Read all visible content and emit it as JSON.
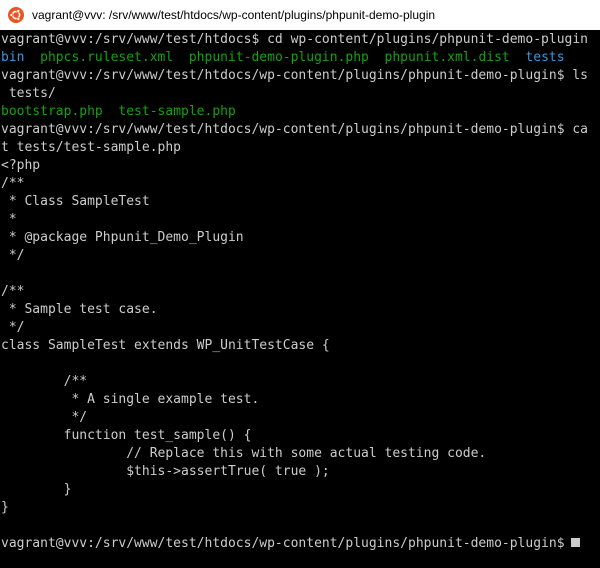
{
  "window": {
    "title": "vagrant@vvv: /srv/www/test/htdocs/wp-content/plugins/phpunit-demo-plugin",
    "icon": "ubuntu-logo-icon",
    "accent_color": "#e95420"
  },
  "terminal": {
    "colors": {
      "text": "#cccccc",
      "file": "#13a10e",
      "directory": "#3a96dd",
      "background": "#000000"
    },
    "lines": [
      "vagrant@vvv:/srv/www/test/htdocs$ cd wp-content/plugins/phpunit-demo-plugin",
      {
        "segments": [
          {
            "text": "bin",
            "style": "blue"
          },
          {
            "text": "  ",
            "style": ""
          },
          {
            "text": "phpcs.ruleset.xml",
            "style": "green"
          },
          {
            "text": "  ",
            "style": ""
          },
          {
            "text": "phpunit-demo-plugin.php",
            "style": "green"
          },
          {
            "text": "  ",
            "style": ""
          },
          {
            "text": "phpunit.xml.dist",
            "style": "green"
          },
          {
            "text": "  ",
            "style": ""
          },
          {
            "text": "tests",
            "style": "blue"
          }
        ]
      },
      "vagrant@vvv:/srv/www/test/htdocs/wp-content/plugins/phpunit-demo-plugin$ ls",
      " tests/",
      {
        "segments": [
          {
            "text": "bootstrap.php",
            "style": "green"
          },
          {
            "text": "  ",
            "style": ""
          },
          {
            "text": "test-sample.php",
            "style": "green"
          }
        ]
      },
      "vagrant@vvv:/srv/www/test/htdocs/wp-content/plugins/phpunit-demo-plugin$ ca",
      "t tests/test-sample.php",
      "<?php",
      "/**",
      " * Class SampleTest",
      " *",
      " * @package Phpunit_Demo_Plugin",
      " */",
      "",
      "/**",
      " * Sample test case.",
      " */",
      "class SampleTest extends WP_UnitTestCase {",
      "",
      "        /**",
      "         * A single example test.",
      "         */",
      "        function test_sample() {",
      "                // Replace this with some actual testing code.",
      "                $this->assertTrue( true );",
      "        }",
      "}"
    ],
    "prompt": "vagrant@vvv:/srv/www/test/htdocs/wp-content/plugins/phpunit-demo-plugin$"
  }
}
